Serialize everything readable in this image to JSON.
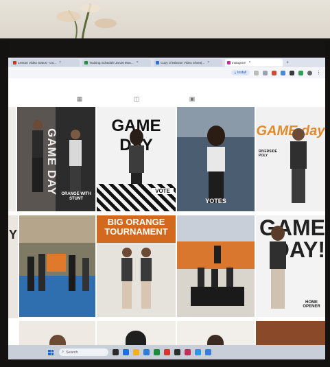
{
  "browser": {
    "tabs": [
      {
        "label": "Lesson Video Status - Go...",
        "fav_color": "#c23b2a",
        "active": false
      },
      {
        "label": "Training Schedule Jan25 Mon...",
        "fav_color": "#1e8e3e",
        "active": false
      },
      {
        "label": "Copy of Mission Video Sheet(...",
        "fav_color": "#2f6fd6",
        "active": false
      },
      {
        "label": "Instagram",
        "fav_color": "#d6249f",
        "active": true
      }
    ],
    "new_tab": "+",
    "install_label": "Install"
  },
  "grid_tabs": [
    "grid-icon",
    "reels-icon",
    "tagged-icon"
  ],
  "posts": [
    {
      "id": "p1",
      "title": "GAME DAY",
      "caption": "ORANGE WITH STUNT",
      "bg": "#3a3a3a",
      "accent": "#f0f0f0"
    },
    {
      "id": "p2",
      "title": "GAME DAY",
      "caption": "VOTE",
      "bg": "#f2f2f2",
      "accent": "#111111"
    },
    {
      "id": "p3",
      "title": "",
      "caption": "YOTES",
      "bg": "#6f7f91",
      "accent": "#ffffff"
    },
    {
      "id": "p4",
      "title": "GAME day",
      "caption": "RIVERSIDE POLY",
      "bg": "#f1f1f1",
      "accent": "#e08a2c"
    },
    {
      "id": "p5",
      "title": "",
      "caption": "",
      "bg": "#5f6a57",
      "accent": "#ffffff"
    },
    {
      "id": "p6",
      "title": "BIG ORANGE TOURNAMENT",
      "caption": "",
      "bg": "#e6e2dc",
      "accent": "#d2691e"
    },
    {
      "id": "p7",
      "title": "",
      "caption": "",
      "bg": "#7a6a5a",
      "accent": "#ffffff"
    },
    {
      "id": "p8",
      "title": "GAME DAY!",
      "caption": "HOME OPENER",
      "bg": "#f3f3f3",
      "accent": "#222222"
    }
  ],
  "left_strip": {
    "letter": "Y"
  },
  "taskbar": {
    "search_label": "Search",
    "apps": [
      "#2b2b2b",
      "#1f6fe0",
      "#f2b01e",
      "#2b7cd6",
      "#1a8c3a",
      "#d33a2c",
      "#2d2d2d",
      "#c72b5a",
      "#2a9ae0",
      "#3c7dd9"
    ]
  }
}
